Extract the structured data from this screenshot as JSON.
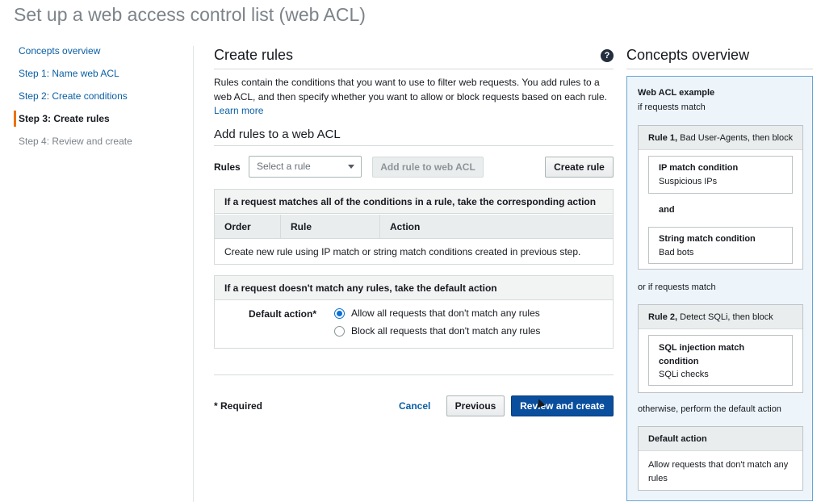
{
  "page": {
    "title": "Set up a web access control list (web ACL)"
  },
  "nav": {
    "items": [
      {
        "label": "Concepts overview",
        "state": "link"
      },
      {
        "label": "Step 1: Name web ACL",
        "state": "link"
      },
      {
        "label": "Step 2: Create conditions",
        "state": "link"
      },
      {
        "label": "Step 3: Create rules",
        "state": "active"
      },
      {
        "label": "Step 4: Review and create",
        "state": "disabled"
      }
    ]
  },
  "main": {
    "title": "Create rules",
    "help_icon": "?",
    "description": "Rules contain the conditions that you want to use to filter web requests. You add rules to a web ACL, and then specify whether you want to allow or block requests based on each rule.",
    "learn_more": "Learn more",
    "add_rules_title": "Add rules to a web ACL",
    "rules_label": "Rules",
    "select_placeholder": "Select a rule",
    "add_rule_button": "Add rule to web ACL",
    "create_rule_button": "Create rule",
    "match_panel": {
      "heading": "If a request matches all of the conditions in a rule, take the corresponding action",
      "columns": [
        "Order",
        "Rule",
        "Action"
      ],
      "empty_text": "Create new rule using IP match or string match conditions created in previous step."
    },
    "default_panel": {
      "heading": "If a request doesn't match any rules, take the default action",
      "label": "Default action*",
      "options": [
        {
          "label": "Allow all requests that don't match any rules",
          "checked": true
        },
        {
          "label": "Block all requests that don't match any rules",
          "checked": false
        }
      ]
    },
    "required_note": "* Required",
    "cancel": "Cancel",
    "previous": "Previous",
    "review_and_create": "Review and create"
  },
  "concepts": {
    "title": "Concepts overview",
    "example_title": "Web ACL example",
    "if_match": "if requests match",
    "rule1": {
      "prefix": "Rule 1,",
      "suffix": " Bad User-Agents, then block",
      "cond1_title": "IP match condition",
      "cond1_value": "Suspicious IPs",
      "and": "and",
      "cond2_title": "String match condition",
      "cond2_value": "Bad bots"
    },
    "or_if_match": "or if requests match",
    "rule2": {
      "prefix": "Rule 2,",
      "suffix": " Detect SQLi, then block",
      "cond_title": "SQL injection match condition",
      "cond_value": "SQLi checks"
    },
    "otherwise": "otherwise, perform the default action",
    "default_action": {
      "title": "Default action",
      "text": "Allow requests that don't match any rules"
    }
  },
  "colors": {
    "accent": "#ec7211",
    "link": "#0b5fa5",
    "primary": "#0a4f9e",
    "concept_bg": "#edf5fb"
  }
}
